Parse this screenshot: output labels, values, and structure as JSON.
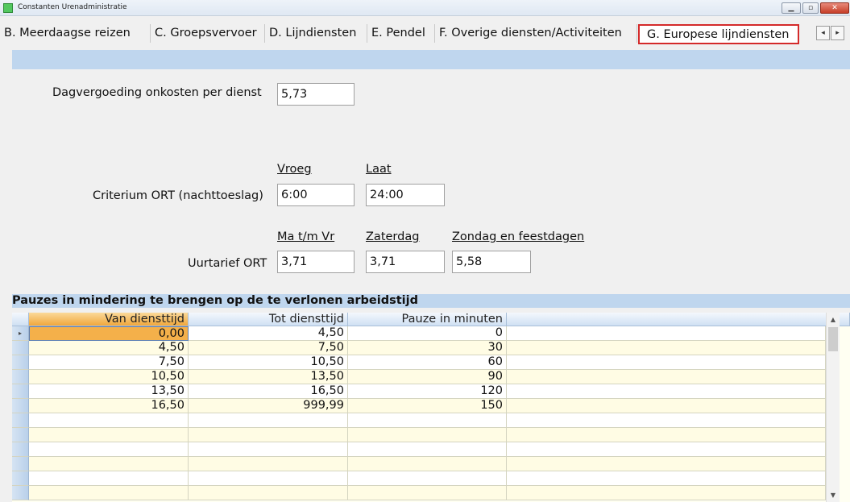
{
  "window": {
    "title": "Constanten Urenadministratie"
  },
  "tabs": [
    {
      "label": "B. Meerdaagse reizen"
    },
    {
      "label": "C. Groepsvervoer"
    },
    {
      "label": "D. Lijndiensten"
    },
    {
      "label": "E. Pendel"
    },
    {
      "label": "F. Overige diensten/Activiteiten"
    },
    {
      "label": "G. Europese lijndiensten"
    }
  ],
  "active_tab": "G. Europese lijndiensten",
  "form": {
    "dagvergoeding_label": "Dagvergoeding onkosten per dienst",
    "dagvergoeding_value": "5,73",
    "vroeg_header": "Vroeg",
    "laat_header": "Laat",
    "criterium_label": "Criterium ORT (nachttoeslag)",
    "criterium_vroeg": "6:00",
    "criterium_laat": "24:00",
    "matmvr_header": "Ma t/m Vr",
    "zaterdag_header": "Zaterdag",
    "zondag_header": "Zondag en feestdagen",
    "uurtarief_label": "Uurtarief ORT",
    "uurtarief_matmvr": "3,71",
    "uurtarief_zaterdag": "3,71",
    "uurtarief_zondag": "5,58"
  },
  "pauzes": {
    "title": "Pauzes in mindering te brengen op de te verlonen arbeidstijd",
    "columns": [
      "Van diensttijd",
      "Tot diensttijd",
      "Pauze in  minuten"
    ],
    "rows": [
      [
        "0,00",
        "4,50",
        "0"
      ],
      [
        "4,50",
        "7,50",
        "30"
      ],
      [
        "7,50",
        "10,50",
        "60"
      ],
      [
        "10,50",
        "13,50",
        "90"
      ],
      [
        "13,50",
        "16,50",
        "120"
      ],
      [
        "16,50",
        "999,99",
        "150"
      ],
      [
        "",
        "",
        ""
      ],
      [
        "",
        "",
        ""
      ],
      [
        "",
        "",
        ""
      ],
      [
        "",
        "",
        ""
      ],
      [
        "",
        "",
        ""
      ],
      [
        "",
        "",
        ""
      ]
    ]
  }
}
